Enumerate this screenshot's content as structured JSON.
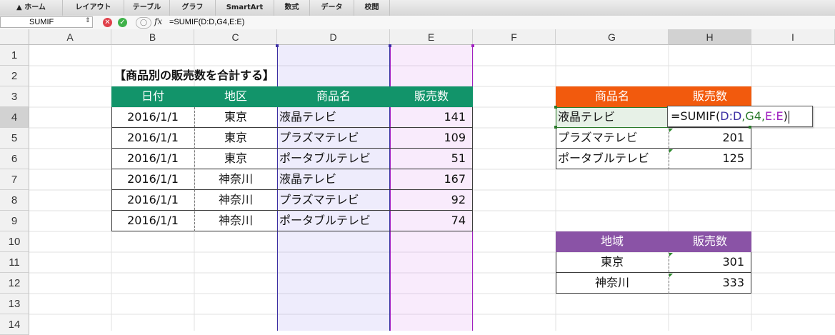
{
  "ribbon": {
    "tabs": [
      "ホーム",
      "レイアウト",
      "テーブル",
      "グラフ",
      "SmartArt",
      "数式",
      "データ",
      "校閲"
    ]
  },
  "formula_bar": {
    "name_box": "SUMIF",
    "fx_label": "fx",
    "formula": "=SUMIF(D:D,G4,E:E)"
  },
  "columns": [
    "A",
    "B",
    "C",
    "D",
    "E",
    "F",
    "G",
    "H",
    "I"
  ],
  "rows": [
    "1",
    "2",
    "3",
    "4",
    "5",
    "6",
    "7",
    "8",
    "9",
    "10",
    "11",
    "12",
    "13",
    "14"
  ],
  "sheet": {
    "title": "【商品別の販売数を合計する】",
    "table1": {
      "headers": [
        "日付",
        "地区",
        "商品名",
        "販売数"
      ],
      "rows": [
        [
          "2016/1/1",
          "東京",
          "液晶テレビ",
          "141"
        ],
        [
          "2016/1/1",
          "東京",
          "プラズマテレビ",
          "109"
        ],
        [
          "2016/1/1",
          "東京",
          "ポータブルテレビ",
          "51"
        ],
        [
          "2016/1/1",
          "神奈川",
          "液晶テレビ",
          "167"
        ],
        [
          "2016/1/1",
          "神奈川",
          "プラズマテレビ",
          "92"
        ],
        [
          "2016/1/1",
          "神奈川",
          "ポータブルテレビ",
          "74"
        ]
      ]
    },
    "table2": {
      "headers": [
        "商品名",
        "販売数"
      ],
      "rows": [
        [
          "液晶テレビ",
          ""
        ],
        [
          "プラズマテレビ",
          "201"
        ],
        [
          "ポータブルテレビ",
          "125"
        ]
      ],
      "editing_formula": "=SUMIF(D:D,G4,E:E)",
      "formula_parts": [
        "=SUMIF(",
        "D:D",
        ",G4,",
        "E:E",
        ")"
      ]
    },
    "table3": {
      "headers": [
        "地域",
        "販売数"
      ],
      "rows": [
        [
          "東京",
          "301"
        ],
        [
          "神奈川",
          "333"
        ]
      ]
    }
  },
  "colors": {
    "table1_header": "#12946a",
    "table2_header": "#f25a0d",
    "table3_header": "#8a53a6",
    "range_d": "#3b2ea3",
    "range_e": "#a020c0",
    "ref_g4": "#2a7a2a"
  }
}
